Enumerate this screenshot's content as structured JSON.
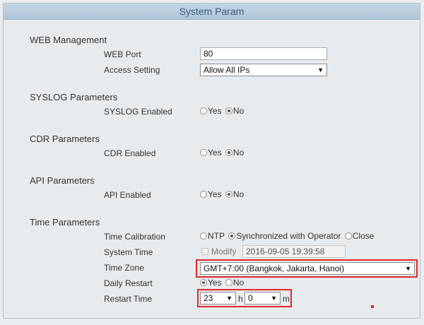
{
  "title": "System Param",
  "web": {
    "section": "WEB Management",
    "port_label": "WEB Port",
    "port_value": "80",
    "access_label": "Access Setting",
    "access_value": "Allow All IPs"
  },
  "syslog": {
    "section": "SYSLOG Parameters",
    "enabled_label": "SYSLOG Enabled",
    "yes": "Yes",
    "no": "No",
    "selected": "No"
  },
  "cdr": {
    "section": "CDR Parameters",
    "enabled_label": "CDR Enabled",
    "yes": "Yes",
    "no": "No",
    "selected": "No"
  },
  "api": {
    "section": "API Parameters",
    "enabled_label": "API Enabled",
    "yes": "Yes",
    "no": "No",
    "selected": "No"
  },
  "time": {
    "section": "Time Parameters",
    "calibration_label": "Time Calibration",
    "calibration_options": [
      "NTP",
      "Synchronized with Operator",
      "Close"
    ],
    "calibration_selected": "Synchronized with Operator",
    "system_time_label": "System Time",
    "modify_label": "Modify",
    "system_time_value": "2016-09-05 19:39:58",
    "timezone_label": "Time Zone",
    "timezone_value": "GMT+7:00 (Bangkok, Jakarta, Hanoi)",
    "daily_restart_label": "Daily Restart",
    "daily_restart_yes": "Yes",
    "daily_restart_no": "No",
    "daily_restart_selected": "Yes",
    "restart_time_label": "Restart Time",
    "restart_hour": "23",
    "hour_unit": "h",
    "restart_minute": "0",
    "minute_unit": "m"
  },
  "colors": {
    "highlight": "#e0262a",
    "title_bg": "#b8cde0",
    "title_text": "#3d5d78"
  },
  "icons": {
    "dropdown": "triangle-down"
  }
}
